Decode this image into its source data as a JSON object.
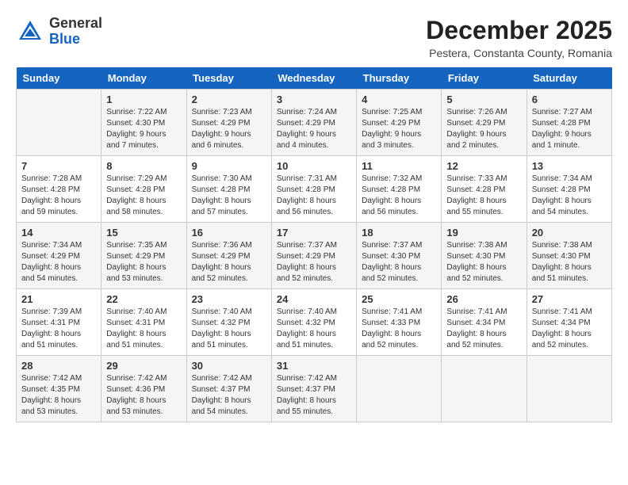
{
  "header": {
    "logo": {
      "general": "General",
      "blue": "Blue"
    },
    "title": "December 2025",
    "location": "Pestera, Constanta County, Romania"
  },
  "calendar": {
    "days_of_week": [
      "Sunday",
      "Monday",
      "Tuesday",
      "Wednesday",
      "Thursday",
      "Friday",
      "Saturday"
    ],
    "weeks": [
      [
        {
          "day": "",
          "info": ""
        },
        {
          "day": "1",
          "info": "Sunrise: 7:22 AM\nSunset: 4:30 PM\nDaylight: 9 hours\nand 7 minutes."
        },
        {
          "day": "2",
          "info": "Sunrise: 7:23 AM\nSunset: 4:29 PM\nDaylight: 9 hours\nand 6 minutes."
        },
        {
          "day": "3",
          "info": "Sunrise: 7:24 AM\nSunset: 4:29 PM\nDaylight: 9 hours\nand 4 minutes."
        },
        {
          "day": "4",
          "info": "Sunrise: 7:25 AM\nSunset: 4:29 PM\nDaylight: 9 hours\nand 3 minutes."
        },
        {
          "day": "5",
          "info": "Sunrise: 7:26 AM\nSunset: 4:29 PM\nDaylight: 9 hours\nand 2 minutes."
        },
        {
          "day": "6",
          "info": "Sunrise: 7:27 AM\nSunset: 4:28 PM\nDaylight: 9 hours\nand 1 minute."
        }
      ],
      [
        {
          "day": "7",
          "info": "Sunrise: 7:28 AM\nSunset: 4:28 PM\nDaylight: 8 hours\nand 59 minutes."
        },
        {
          "day": "8",
          "info": "Sunrise: 7:29 AM\nSunset: 4:28 PM\nDaylight: 8 hours\nand 58 minutes."
        },
        {
          "day": "9",
          "info": "Sunrise: 7:30 AM\nSunset: 4:28 PM\nDaylight: 8 hours\nand 57 minutes."
        },
        {
          "day": "10",
          "info": "Sunrise: 7:31 AM\nSunset: 4:28 PM\nDaylight: 8 hours\nand 56 minutes."
        },
        {
          "day": "11",
          "info": "Sunrise: 7:32 AM\nSunset: 4:28 PM\nDaylight: 8 hours\nand 56 minutes."
        },
        {
          "day": "12",
          "info": "Sunrise: 7:33 AM\nSunset: 4:28 PM\nDaylight: 8 hours\nand 55 minutes."
        },
        {
          "day": "13",
          "info": "Sunrise: 7:34 AM\nSunset: 4:28 PM\nDaylight: 8 hours\nand 54 minutes."
        }
      ],
      [
        {
          "day": "14",
          "info": "Sunrise: 7:34 AM\nSunset: 4:29 PM\nDaylight: 8 hours\nand 54 minutes."
        },
        {
          "day": "15",
          "info": "Sunrise: 7:35 AM\nSunset: 4:29 PM\nDaylight: 8 hours\nand 53 minutes."
        },
        {
          "day": "16",
          "info": "Sunrise: 7:36 AM\nSunset: 4:29 PM\nDaylight: 8 hours\nand 52 minutes."
        },
        {
          "day": "17",
          "info": "Sunrise: 7:37 AM\nSunset: 4:29 PM\nDaylight: 8 hours\nand 52 minutes."
        },
        {
          "day": "18",
          "info": "Sunrise: 7:37 AM\nSunset: 4:30 PM\nDaylight: 8 hours\nand 52 minutes."
        },
        {
          "day": "19",
          "info": "Sunrise: 7:38 AM\nSunset: 4:30 PM\nDaylight: 8 hours\nand 52 minutes."
        },
        {
          "day": "20",
          "info": "Sunrise: 7:38 AM\nSunset: 4:30 PM\nDaylight: 8 hours\nand 51 minutes."
        }
      ],
      [
        {
          "day": "21",
          "info": "Sunrise: 7:39 AM\nSunset: 4:31 PM\nDaylight: 8 hours\nand 51 minutes."
        },
        {
          "day": "22",
          "info": "Sunrise: 7:40 AM\nSunset: 4:31 PM\nDaylight: 8 hours\nand 51 minutes."
        },
        {
          "day": "23",
          "info": "Sunrise: 7:40 AM\nSunset: 4:32 PM\nDaylight: 8 hours\nand 51 minutes."
        },
        {
          "day": "24",
          "info": "Sunrise: 7:40 AM\nSunset: 4:32 PM\nDaylight: 8 hours\nand 51 minutes."
        },
        {
          "day": "25",
          "info": "Sunrise: 7:41 AM\nSunset: 4:33 PM\nDaylight: 8 hours\nand 52 minutes."
        },
        {
          "day": "26",
          "info": "Sunrise: 7:41 AM\nSunset: 4:34 PM\nDaylight: 8 hours\nand 52 minutes."
        },
        {
          "day": "27",
          "info": "Sunrise: 7:41 AM\nSunset: 4:34 PM\nDaylight: 8 hours\nand 52 minutes."
        }
      ],
      [
        {
          "day": "28",
          "info": "Sunrise: 7:42 AM\nSunset: 4:35 PM\nDaylight: 8 hours\nand 53 minutes."
        },
        {
          "day": "29",
          "info": "Sunrise: 7:42 AM\nSunset: 4:36 PM\nDaylight: 8 hours\nand 53 minutes."
        },
        {
          "day": "30",
          "info": "Sunrise: 7:42 AM\nSunset: 4:37 PM\nDaylight: 8 hours\nand 54 minutes."
        },
        {
          "day": "31",
          "info": "Sunrise: 7:42 AM\nSunset: 4:37 PM\nDaylight: 8 hours\nand 55 minutes."
        },
        {
          "day": "",
          "info": ""
        },
        {
          "day": "",
          "info": ""
        },
        {
          "day": "",
          "info": ""
        }
      ]
    ]
  }
}
